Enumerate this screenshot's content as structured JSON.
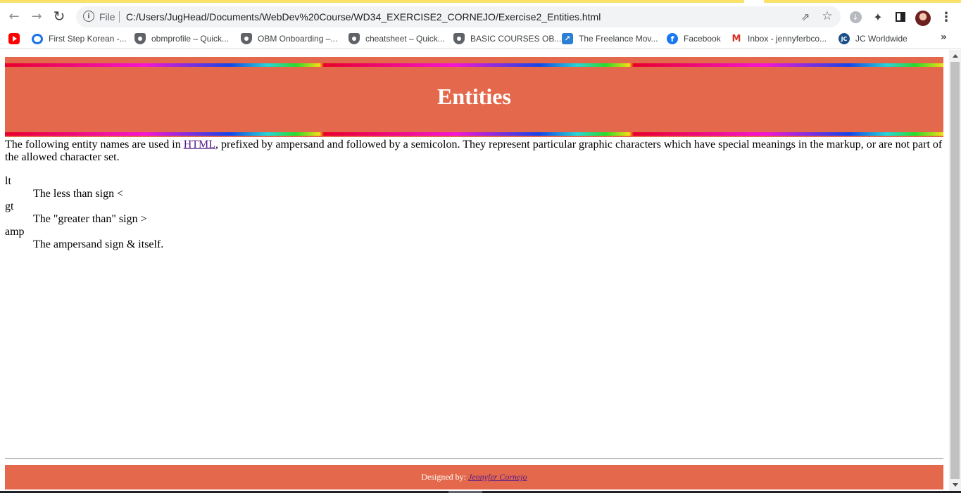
{
  "browser": {
    "scheme_label": "File",
    "url": "C:/Users/JugHead/Documents/WebDev%20Course/WD34_EXERCISE2_CORNEJO/Exercise2_Entities.html",
    "icons": {
      "back": "arrow-left-icon",
      "forward": "arrow-right-icon",
      "reload": "reload-icon",
      "info": "info-icon",
      "share": "share-icon",
      "bookmark": "star-icon",
      "download": "download-icon",
      "extensions": "puzzle-icon",
      "side_panel": "side-panel-icon",
      "profile": "avatar",
      "menu": "kebab-menu-icon"
    }
  },
  "bookmarks": [
    {
      "label": "",
      "icon": "youtube-icon"
    },
    {
      "label": "First Step Korean -...",
      "icon": "coursera-icon"
    },
    {
      "label": "obmprofile – Quick...",
      "icon": "shield-icon"
    },
    {
      "label": "OBM Onboarding –...",
      "icon": "shield-icon"
    },
    {
      "label": "cheatsheet – Quick...",
      "icon": "shield-icon"
    },
    {
      "label": "BASIC COURSES OB...",
      "icon": "shield-icon"
    },
    {
      "label": "The Freelance Mov...",
      "icon": "freelance-icon"
    },
    {
      "label": "Facebook",
      "icon": "facebook-icon"
    },
    {
      "label": "Inbox - jennyferbco...",
      "icon": "gmail-icon"
    },
    {
      "label": "JC Worldwide",
      "icon": "jc-icon"
    }
  ],
  "bookmarks_more": "»",
  "page": {
    "title": "Entities",
    "intro_before": "The following entity names are used in ",
    "intro_link": "HTML",
    "intro_after": ", prefixed by ampersand and followed by a semicolon. They represent particular graphic characters which have special meanings in the markup, or are not part of the allowed character set.",
    "entities": [
      {
        "name": "lt",
        "description": "The less than sign <"
      },
      {
        "name": "gt",
        "description": "The \"greater than\" sign >"
      },
      {
        "name": "amp",
        "description": "The ampersand sign & itself."
      }
    ],
    "footer_label": "Designed by: ",
    "footer_link": "Jennyfer Cornejo"
  },
  "colors": {
    "header_bg": "#e4694c",
    "link": "#551a8b",
    "chrome_accent": "#f9e16a"
  }
}
